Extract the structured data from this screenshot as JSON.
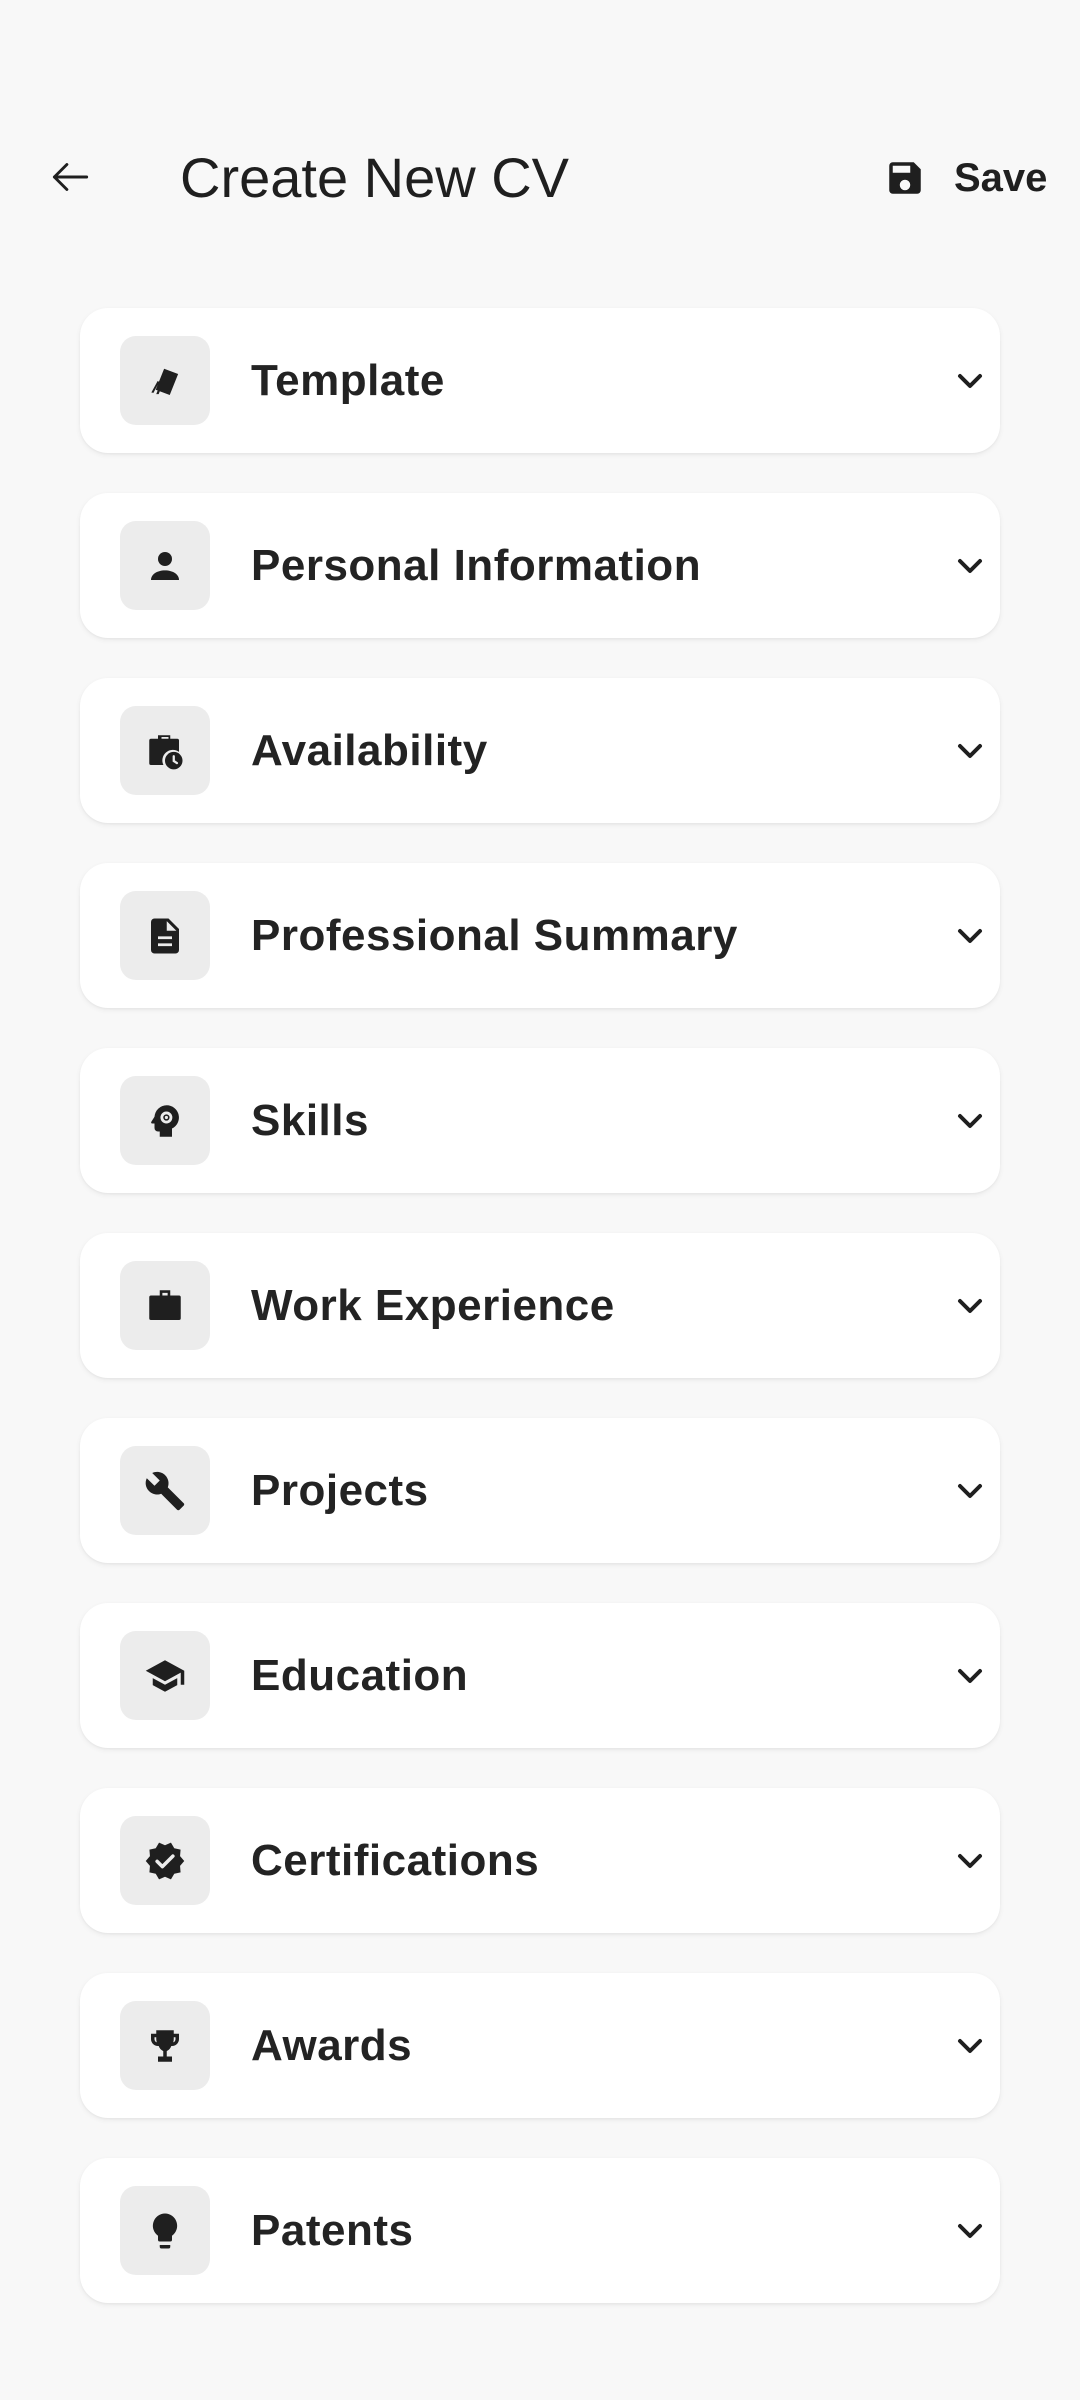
{
  "header": {
    "title": "Create New CV",
    "back_icon": "arrow-left-icon",
    "save_label": "Save",
    "save_icon": "floppy-disk-icon"
  },
  "sections": [
    {
      "label": "Template",
      "icon": "palette-swatch-icon"
    },
    {
      "label": "Personal Information",
      "icon": "person-icon"
    },
    {
      "label": "Availability",
      "icon": "briefcase-clock-icon"
    },
    {
      "label": "Professional Summary",
      "icon": "document-icon"
    },
    {
      "label": "Skills",
      "icon": "head-gear-icon"
    },
    {
      "label": "Work Experience",
      "icon": "briefcase-icon"
    },
    {
      "label": "Projects",
      "icon": "wrench-icon"
    },
    {
      "label": "Education",
      "icon": "graduation-cap-icon"
    },
    {
      "label": "Certifications",
      "icon": "verified-badge-icon"
    },
    {
      "label": "Awards",
      "icon": "trophy-icon"
    },
    {
      "label": "Patents",
      "icon": "lightbulb-icon"
    }
  ],
  "colors": {
    "background": "#f8f8f8",
    "card": "#ffffff",
    "icon_box": "#ececec",
    "text": "#232323"
  }
}
